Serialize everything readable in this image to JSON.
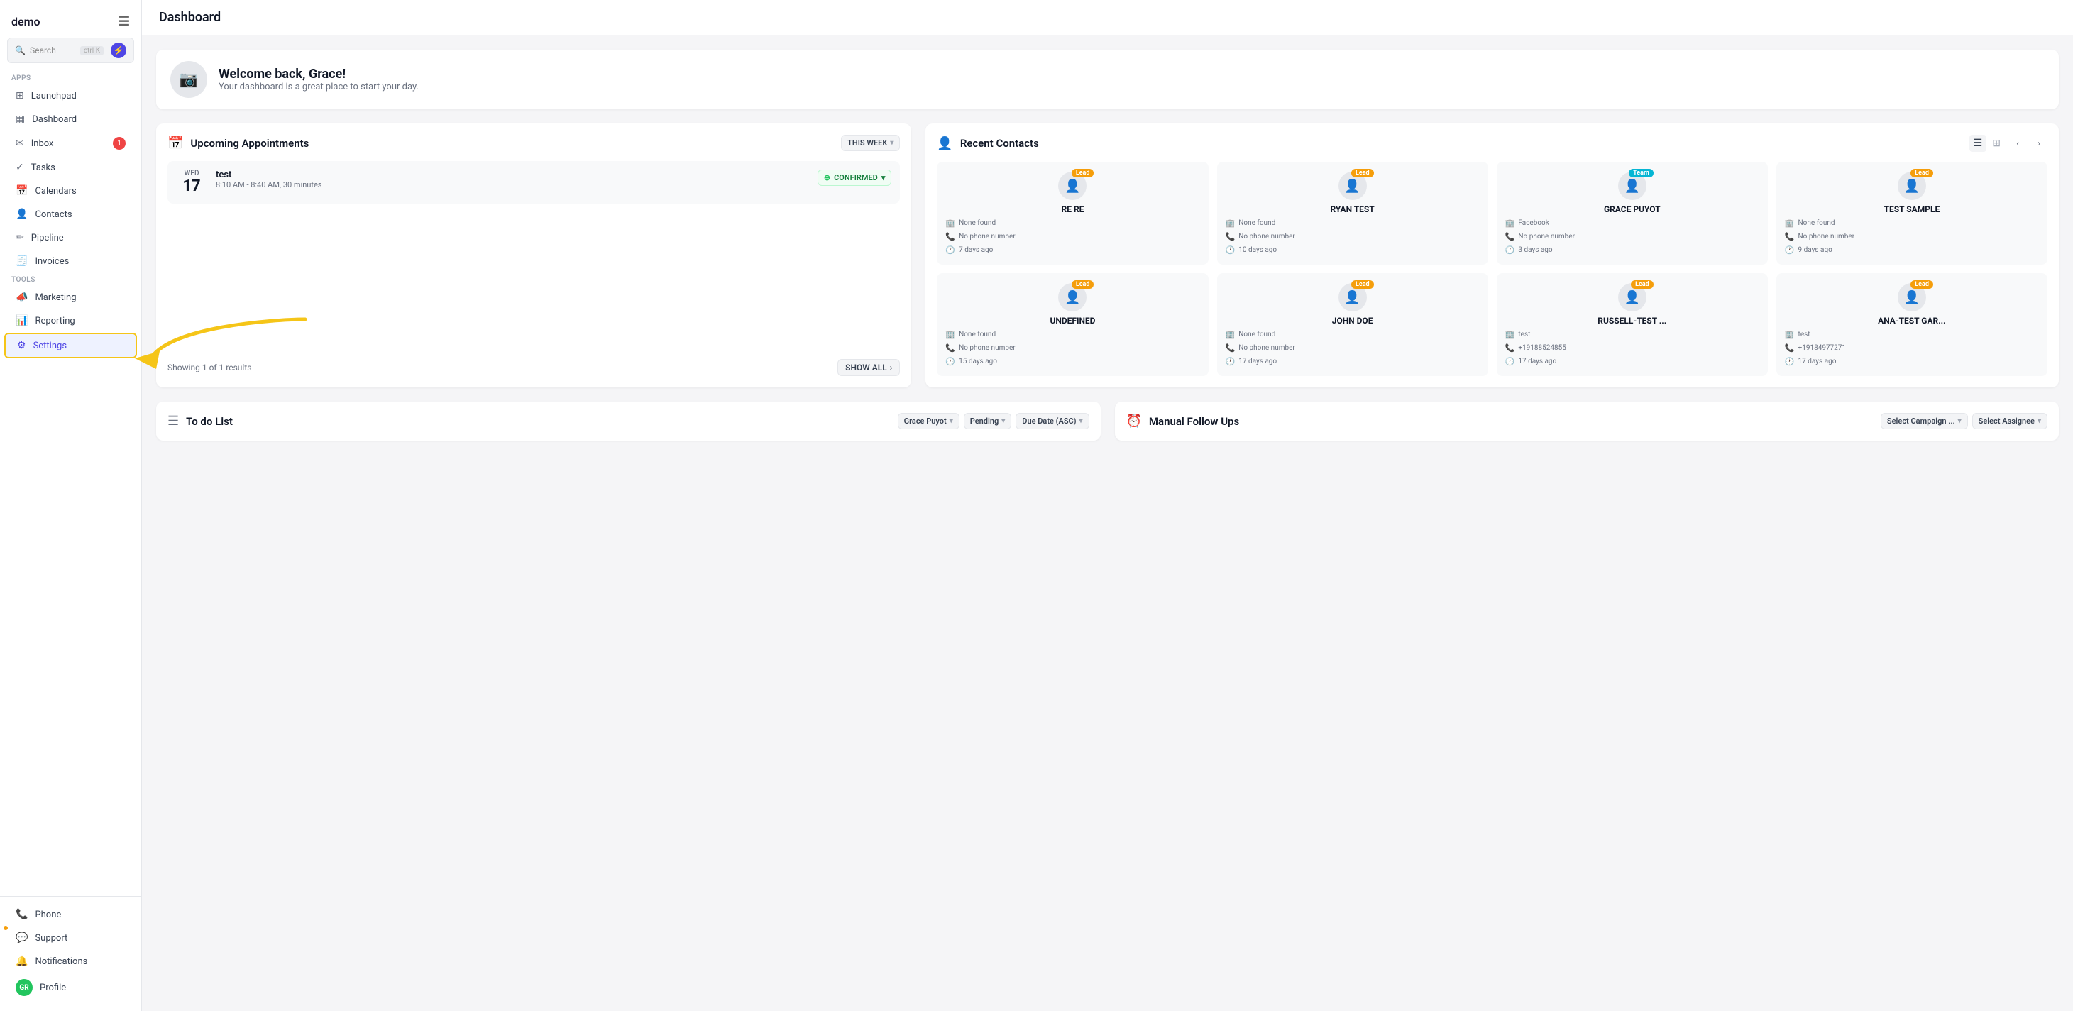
{
  "app": {
    "logo": "demo",
    "title": "Dashboard"
  },
  "sidebar": {
    "search_label": "Search",
    "search_shortcut": "ctrl K",
    "sections": [
      {
        "label": "Apps",
        "items": [
          {
            "id": "launchpad",
            "label": "Launchpad",
            "icon": "⊞"
          },
          {
            "id": "dashboard",
            "label": "Dashboard",
            "icon": "▦"
          },
          {
            "id": "inbox",
            "label": "Inbox",
            "icon": "✉",
            "badge": "1"
          },
          {
            "id": "tasks",
            "label": "Tasks",
            "icon": "✓"
          },
          {
            "id": "calendars",
            "label": "Calendars",
            "icon": "📅"
          },
          {
            "id": "contacts",
            "label": "Contacts",
            "icon": "👤"
          },
          {
            "id": "pipeline",
            "label": "Pipeline",
            "icon": "✏"
          },
          {
            "id": "invoices",
            "label": "Invoices",
            "icon": "🧾"
          }
        ]
      },
      {
        "label": "Tools",
        "items": [
          {
            "id": "marketing",
            "label": "Marketing",
            "icon": "📣"
          },
          {
            "id": "reporting",
            "label": "Reporting",
            "icon": "📊"
          },
          {
            "id": "settings",
            "label": "Settings",
            "icon": "⚙",
            "active": true
          }
        ]
      }
    ],
    "bottom_items": [
      {
        "id": "phone",
        "label": "Phone",
        "icon": "📞"
      },
      {
        "id": "support",
        "label": "Support",
        "icon": "💬"
      },
      {
        "id": "notifications",
        "label": "Notifications",
        "icon": "🔔"
      },
      {
        "id": "profile",
        "label": "Profile",
        "icon": "👤"
      }
    ]
  },
  "welcome": {
    "title": "Welcome back, Grace!",
    "subtitle": "Your dashboard is a great place to start your day."
  },
  "appointments": {
    "section_title": "Upcoming Appointments",
    "filter_label": "THIS WEEK",
    "items": [
      {
        "day_label": "WED",
        "day_num": "17",
        "name": "test",
        "time": "8:10 AM - 8:40 AM, 30 minutes",
        "status": "CONFIRMED"
      }
    ],
    "showing_label": "Showing 1 of 1 results",
    "show_all_label": "SHOW ALL"
  },
  "contacts": {
    "section_title": "Recent Contacts",
    "cards": [
      {
        "name": "RE RE",
        "badge": "Lead",
        "badge_type": "lead",
        "company": "None found",
        "phone": "No phone number",
        "time": "7 days ago"
      },
      {
        "name": "RYAN TEST",
        "badge": "Lead",
        "badge_type": "lead",
        "company": "None found",
        "phone": "No phone number",
        "time": "10 days ago"
      },
      {
        "name": "GRACE PUYOT",
        "badge": "Team",
        "badge_type": "team",
        "company": "Facebook",
        "phone": "No phone number",
        "time": "3 days ago"
      },
      {
        "name": "TEST SAMPLE",
        "badge": "Lead",
        "badge_type": "lead",
        "company": "None found",
        "phone": "No phone number",
        "time": "9 days ago"
      },
      {
        "name": "UNDEFINED",
        "badge": "Lead",
        "badge_type": "lead",
        "company": "None found",
        "phone": "No phone number",
        "time": "15 days ago"
      },
      {
        "name": "JOHN DOE",
        "badge": "Lead",
        "badge_type": "lead",
        "company": "None found",
        "phone": "No phone number",
        "time": "17 days ago"
      },
      {
        "name": "RUSSELL-TEST ...",
        "badge": "Lead",
        "badge_type": "lead",
        "company": "test",
        "phone": "+19188524855",
        "time": "17 days ago"
      },
      {
        "name": "ANA-TEST GAR...",
        "badge": "Lead",
        "badge_type": "lead",
        "company": "test",
        "phone": "+19184977271",
        "time": "17 days ago"
      }
    ]
  },
  "todo": {
    "section_title": "To do List",
    "filters": [
      {
        "label": "Grace Puyot",
        "has_chevron": true
      },
      {
        "label": "Pending",
        "has_chevron": true
      },
      {
        "label": "Due Date (ASC)",
        "has_chevron": true
      }
    ]
  },
  "manual_follow_ups": {
    "section_title": "Manual Follow Ups",
    "select_campaign_label": "Select Campaign ...",
    "select_assignee_label": "Select Assignee"
  }
}
